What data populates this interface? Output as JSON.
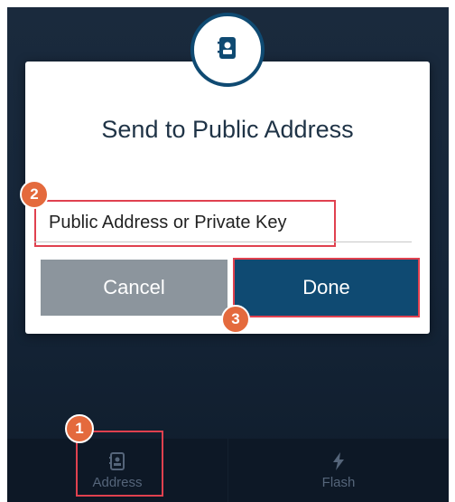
{
  "dialog": {
    "title": "Send to Public Address",
    "icon": "address-book-icon",
    "input_placeholder": "Public Address or Private Key",
    "cancel_label": "Cancel",
    "done_label": "Done"
  },
  "tabs": [
    {
      "label": "Address",
      "icon": "address-book-icon"
    },
    {
      "label": "Flash",
      "icon": "lightning-icon"
    }
  ],
  "annotations": {
    "step1": "1",
    "step2": "2",
    "step3": "3"
  },
  "colors": {
    "primary": "#0f4a72",
    "highlight": "#e0414f",
    "badge": "#e46a3d"
  }
}
